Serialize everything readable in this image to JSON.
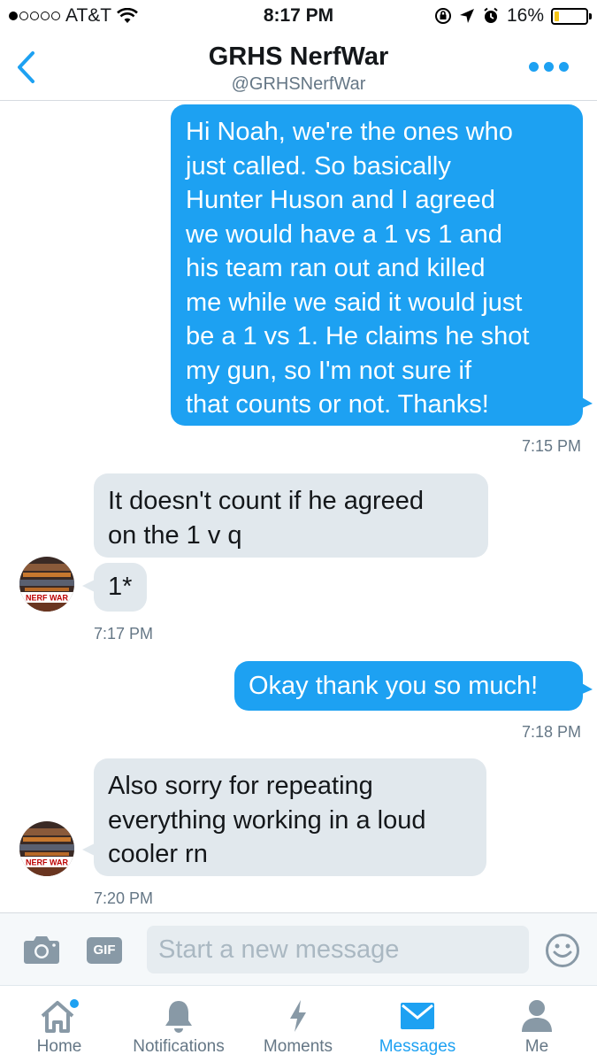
{
  "status_bar": {
    "carrier": "AT&T",
    "time": "8:17 PM",
    "battery": "16%",
    "battery_level": 0.16,
    "signal_bars": 1
  },
  "header": {
    "title": "GRHS NerfWar",
    "handle": "@GRHSNerfWar"
  },
  "messages": [
    {
      "direction": "sent",
      "lines": [
        "Hi Noah, we're the ones who",
        "just called. So basically",
        "Hunter Huson and I agreed",
        "we would have a 1 vs 1 and",
        "his team ran out and killed",
        "me while we said it would just",
        "be a 1 vs 1. He claims he shot",
        "my gun, so I'm not sure if",
        "that counts or not. Thanks!"
      ],
      "time": "7:15 PM"
    },
    {
      "direction": "received",
      "lines": [
        "It doesn't count if he agreed",
        "on the 1 v q"
      ]
    },
    {
      "direction": "received",
      "lines": [
        "1*"
      ],
      "time": "7:17 PM"
    },
    {
      "direction": "sent",
      "lines": [
        "Okay thank you so much!"
      ],
      "time": "7:18 PM"
    },
    {
      "direction": "received",
      "lines": [
        "Also sorry for repeating",
        "everything working in a loud",
        "cooler rn"
      ],
      "time": "7:20 PM"
    }
  ],
  "avatar_text": "NERF WAR",
  "composer": {
    "gif_label": "GIF",
    "placeholder": "Start a new message"
  },
  "tabs": [
    {
      "label": "Home",
      "icon": "home-icon",
      "badge": true
    },
    {
      "label": "Notifications",
      "icon": "bell-icon"
    },
    {
      "label": "Moments",
      "icon": "lightning-icon"
    },
    {
      "label": "Messages",
      "icon": "envelope-icon",
      "active": true
    },
    {
      "label": "Me",
      "icon": "person-icon"
    }
  ],
  "colors": {
    "accent": "#1da1f2",
    "received_bubble": "#e1e8ed",
    "muted_text": "#657786"
  }
}
